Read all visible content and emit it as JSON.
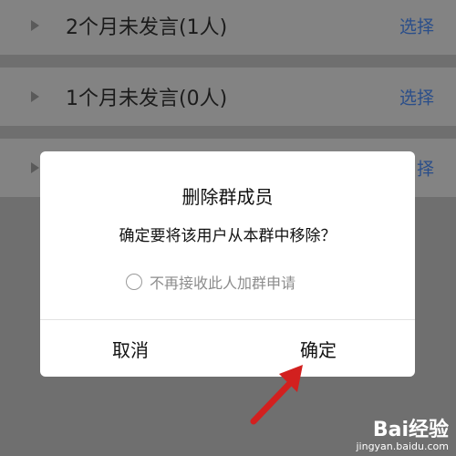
{
  "list": {
    "rows": [
      {
        "label": "2个月未发言(1人)",
        "action": "选择"
      },
      {
        "label": "1个月未发言(0人)",
        "action": "选择"
      },
      {
        "label": "",
        "action": "择"
      }
    ]
  },
  "dialog": {
    "title": "删除群成员",
    "message": "确定要将该用户从本群中移除？",
    "checkbox_label": "不再接收此人加群申请",
    "cancel_label": "取消",
    "confirm_label": "确定"
  },
  "watermark": {
    "logo": "Bai经验",
    "url": "jingyan.baidu.com"
  },
  "colors": {
    "overlay_background": "#6f6f6f",
    "link": "#2a4e8a",
    "arrow": "#d2201f"
  }
}
